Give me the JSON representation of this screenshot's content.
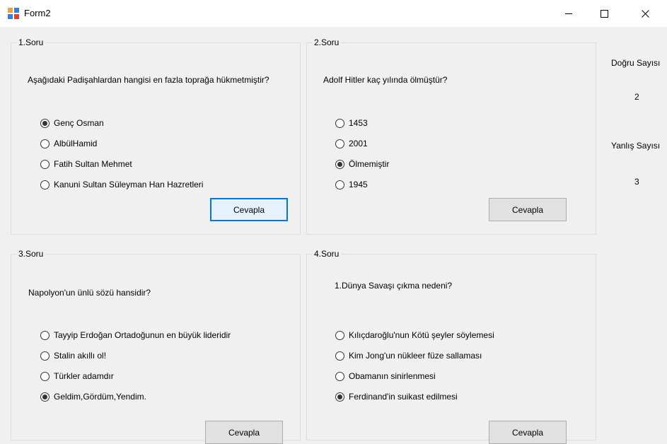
{
  "window": {
    "title": "Form2"
  },
  "questions": [
    {
      "legend": "1.Soru",
      "text": "Aşağıdaki Padişahlardan hangisi en fazla toprağa hükmetmiştir?",
      "options": [
        {
          "label": "Genç Osman",
          "checked": true
        },
        {
          "label": "AlbülHamid",
          "checked": false
        },
        {
          "label": "Fatih Sultan Mehmet",
          "checked": false
        },
        {
          "label": "Kanuni Sultan Süleyman Han Hazretleri",
          "checked": false
        }
      ],
      "button": "Cevapla"
    },
    {
      "legend": "2.Soru",
      "text": "Adolf Hitler kaç yılında ölmüştür?",
      "options": [
        {
          "label": "1453",
          "checked": false
        },
        {
          "label": "2001",
          "checked": false
        },
        {
          "label": "Ölmemiştir",
          "checked": true
        },
        {
          "label": "1945",
          "checked": false
        }
      ],
      "button": "Cevapla"
    },
    {
      "legend": "3.Soru",
      "text": "Napolyon'un ünlü sözü hansidir?",
      "options": [
        {
          "label": "Tayyip Erdoğan Ortadoğunun en büyük lideridir",
          "checked": false
        },
        {
          "label": "Stalin akıllı ol!",
          "checked": false
        },
        {
          "label": "Türkler adamdır",
          "checked": false
        },
        {
          "label": "Geldim,Gördüm,Yendim.",
          "checked": true
        }
      ],
      "button": "Cevapla"
    },
    {
      "legend": "4.Soru",
      "text": "1.Dünya Savaşı çıkma nedeni?",
      "options": [
        {
          "label": "Kılıçdaroğlu'nun Kötü şeyler söylemesi",
          "checked": false
        },
        {
          "label": "Kim Jong'un nükleer füze sallaması",
          "checked": false
        },
        {
          "label": "Obamanın sinirlenmesi",
          "checked": false
        },
        {
          "label": "Ferdinand'in suikast edilmesi",
          "checked": true
        }
      ],
      "button": "Cevapla"
    }
  ],
  "stats": {
    "correct_label": "Doğru Sayısı",
    "correct_value": "2",
    "wrong_label": "Yanlış Sayısı",
    "wrong_value": "3"
  }
}
